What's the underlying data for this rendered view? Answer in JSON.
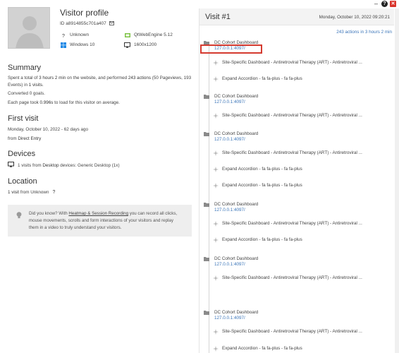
{
  "window": {
    "minimize": "–",
    "help": "?",
    "close": "✕"
  },
  "profile": {
    "title": "Visitor profile",
    "visitor_id": "ID a8914855c701a407",
    "browser_unknown": "Unknown",
    "engine": "QtWebEngine 5.12",
    "os": "Windows 10",
    "resolution": "1600x1200"
  },
  "summary": {
    "title": "Summary",
    "line1_a": "Spent a total of ",
    "line1_b": "3 hours 2 min",
    "line1_c": " on the website, and performed ",
    "line1_d": "243 actions",
    "line1_e": " (50 Pageviews, 193",
    "line2_a": "Events) in ",
    "line2_b": "1 visits",
    "line2_c": ".",
    "converted": "Converted 0 goals.",
    "load_a": "Each page took ",
    "load_b": "0.996s",
    "load_c": " to load for this visitor on average."
  },
  "first_visit": {
    "title": "First visit",
    "date": "Monday, October 10, 2022 - 62 days ago",
    "from_a": "from ",
    "from_b": "Direct Entry"
  },
  "devices": {
    "title": "Devices",
    "a": "1 visits from ",
    "b": "Desktop",
    "c": " devices: Generic Desktop (1x)"
  },
  "location": {
    "title": "Location",
    "a": "1 visit",
    "b": " from Unknown",
    "flag": "?"
  },
  "tip": {
    "a": "Did you know? With ",
    "link": "Heatmap & Session Recording",
    "b": " you can record all clicks,",
    "line2": "mouse movements, scrolls and form interactions of your visitors and replay",
    "line3": "them in a video to truly understand your visitors."
  },
  "visit": {
    "title": "Visit #1",
    "date": "Monday, October 10, 2022 09:20:21",
    "actions": "243 actions in 3 hours 2 min",
    "page_title": "DC Cohort Dashboard",
    "page_url": "127.0.0.1:4097/",
    "event_site": "Site-Specific Dashboard - Antiretroviral Therapy (ART) - Antiretroviral ...",
    "event_expand": "Expand Accordion - fa fa-plus - fa fa-plus"
  }
}
